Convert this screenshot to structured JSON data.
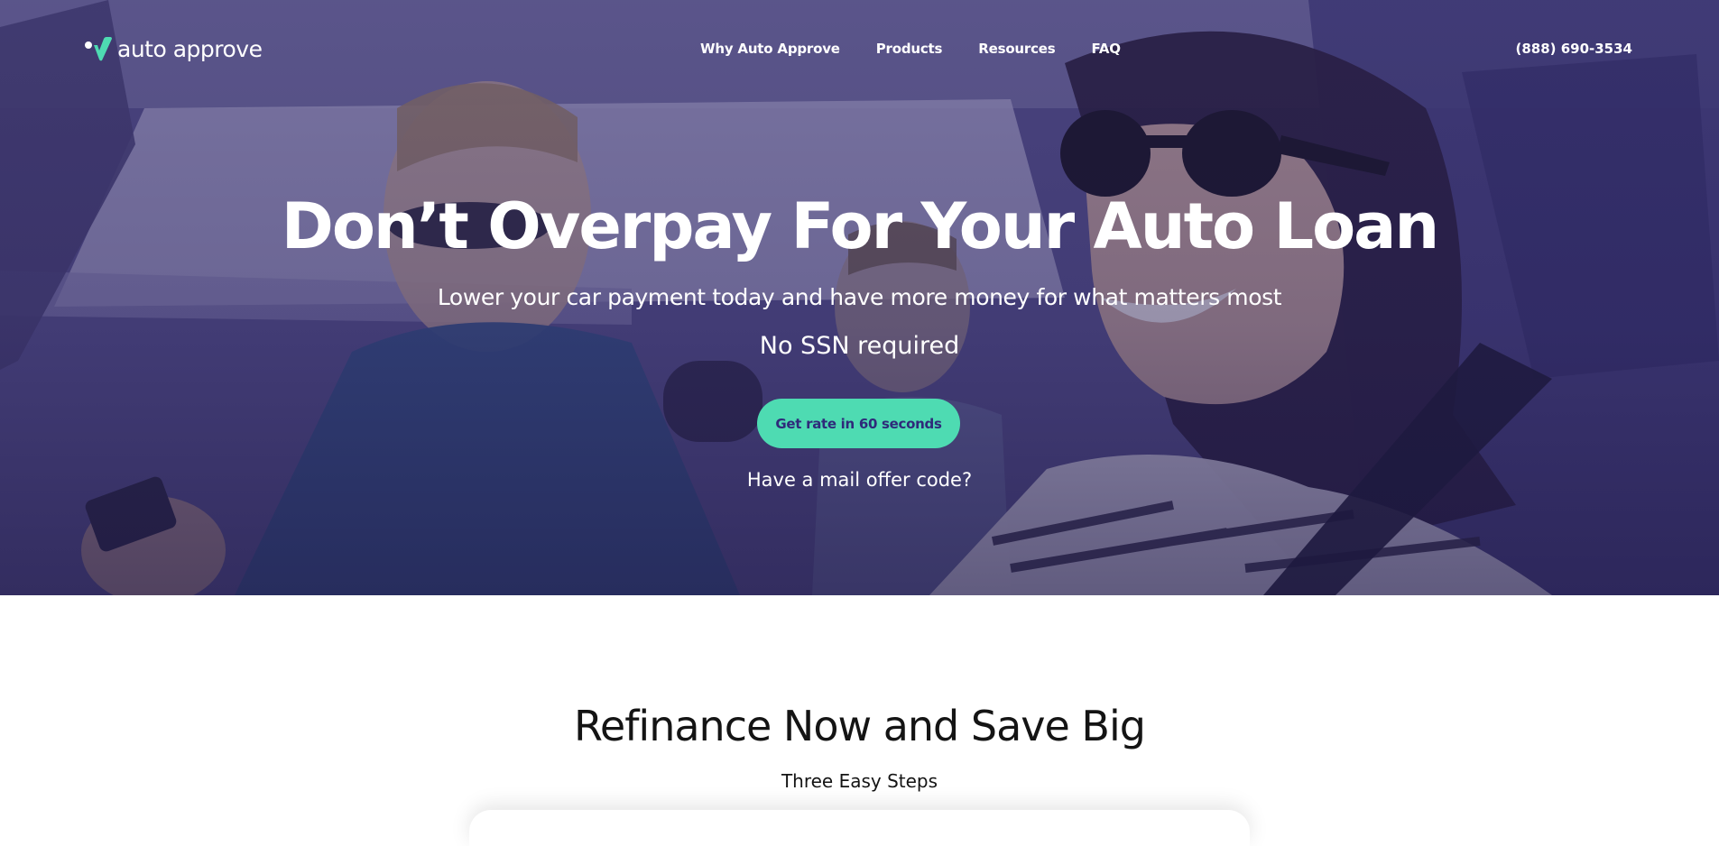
{
  "brand": {
    "name": "auto approve",
    "accent_color": "#4edbb2",
    "primary_color": "#2f2a7a"
  },
  "nav": {
    "links": [
      {
        "label": "Why Auto Approve"
      },
      {
        "label": "Products"
      },
      {
        "label": "Resources"
      },
      {
        "label": "FAQ"
      }
    ],
    "phone": "(888) 690-3534"
  },
  "hero": {
    "title": "Don’t Overpay For Your Auto Loan",
    "subtitle": "Lower your car payment today and have more money for what matters most",
    "ssn_note": "No SSN required",
    "cta_label": "Get rate in 60 seconds",
    "mail_offer_link": "Have a mail offer code?",
    "background_image": "photo-family-in-car"
  },
  "steps_section": {
    "title": "Refinance Now and Save Big",
    "subtitle": "Three Easy Steps"
  }
}
